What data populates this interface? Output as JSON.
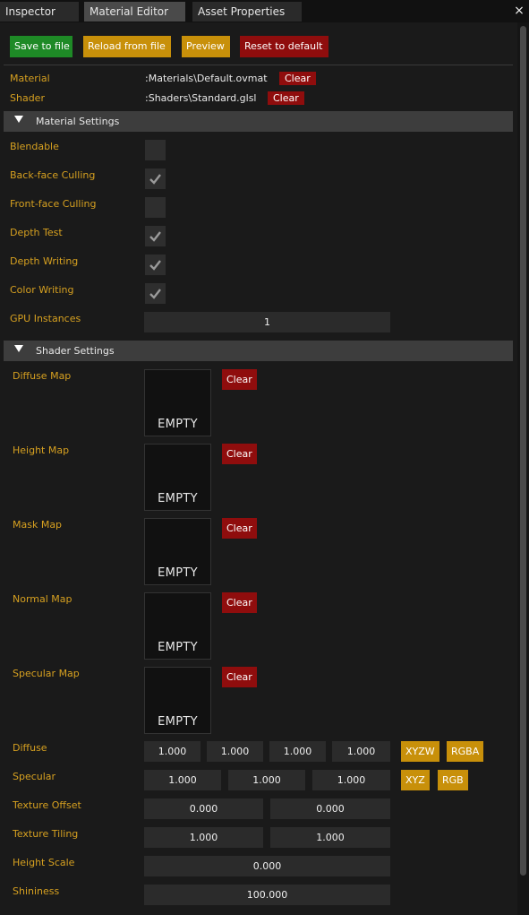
{
  "tabs": [
    "Inspector",
    "Material Editor",
    "Asset Properties"
  ],
  "close_icon": "×",
  "toolbar": {
    "save": "Save to file",
    "reload": "Reload from file",
    "preview": "Preview",
    "reset": "Reset to default"
  },
  "material": {
    "label": "Material",
    "value": ":Materials\\Default.ovmat",
    "clear": "Clear"
  },
  "shader": {
    "label": "Shader",
    "value": ":Shaders\\Standard.glsl",
    "clear": "Clear"
  },
  "material_settings": {
    "title": "Material Settings",
    "blendable": {
      "label": "Blendable",
      "checked": false
    },
    "back_face_culling": {
      "label": "Back-face Culling",
      "checked": true
    },
    "front_face_culling": {
      "label": "Front-face Culling",
      "checked": false
    },
    "depth_test": {
      "label": "Depth Test",
      "checked": true
    },
    "depth_writing": {
      "label": "Depth Writing",
      "checked": true
    },
    "color_writing": {
      "label": "Color Writing",
      "checked": true
    },
    "gpu_instances": {
      "label": "GPU Instances",
      "value": "1"
    }
  },
  "shader_settings": {
    "title": "Shader Settings",
    "diffuse_map": {
      "label": "Diffuse Map",
      "preview": "EMPTY",
      "clear": "Clear"
    },
    "height_map": {
      "label": "Height Map",
      "preview": "EMPTY",
      "clear": "Clear"
    },
    "mask_map": {
      "label": "Mask Map",
      "preview": "EMPTY",
      "clear": "Clear"
    },
    "normal_map": {
      "label": "Normal Map",
      "preview": "EMPTY",
      "clear": "Clear"
    },
    "specular_map": {
      "label": "Specular Map",
      "preview": "EMPTY",
      "clear": "Clear"
    },
    "diffuse": {
      "label": "Diffuse",
      "x": "1.000",
      "y": "1.000",
      "z": "1.000",
      "w": "1.000",
      "btn1": "XYZW",
      "btn2": "RGBA"
    },
    "specular": {
      "label": "Specular",
      "x": "1.000",
      "y": "1.000",
      "z": "1.000",
      "btn1": "XYZ",
      "btn2": "RGB"
    },
    "texture_offset": {
      "label": "Texture Offset",
      "x": "0.000",
      "y": "0.000"
    },
    "texture_tiling": {
      "label": "Texture Tiling",
      "x": "1.000",
      "y": "1.000"
    },
    "height_scale": {
      "label": "Height Scale",
      "value": "0.000"
    },
    "shininess": {
      "label": "Shininess",
      "value": "100.000"
    }
  },
  "colors": {
    "label": "#d6a020",
    "save_button": "#1e8a26",
    "warning_button": "#c8900a",
    "danger_button": "#8f0d0d"
  }
}
